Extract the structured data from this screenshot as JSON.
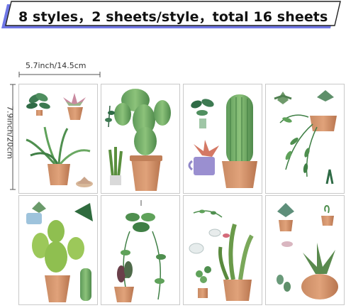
{
  "banner": {
    "text": "8 styles，2 sheets/style，total 16 sheets"
  },
  "dimensions": {
    "width_label": "5.7inch/14.5cm",
    "height_label": "7.9inch/20cm"
  },
  "sheets": [
    {
      "name": "sheet-1",
      "subjects": [
        "calathea",
        "succulent-in-pot",
        "snake-grass-pot",
        "small-succulent"
      ]
    },
    {
      "name": "sheet-2",
      "subjects": [
        "paddle-cactus-pot",
        "hanging-leaves",
        "snake-plant-small"
      ]
    },
    {
      "name": "sheet-3",
      "subjects": [
        "calathea-small",
        "tall-cactus-pot",
        "bromeliad-mug"
      ]
    },
    {
      "name": "sheet-4",
      "subjects": [
        "echeveria",
        "succulent",
        "hanging-vine-pot",
        "fern"
      ]
    },
    {
      "name": "sheet-5",
      "subjects": [
        "succulent-cup",
        "monstera-leaf",
        "prickly-pear-pot",
        "columnar-cactus"
      ]
    },
    {
      "name": "sheet-6",
      "subjects": [
        "hanging-pothos",
        "begonia-pot"
      ]
    },
    {
      "name": "sheet-7",
      "subjects": [
        "vine-sprig",
        "leaf-stickers",
        "pilea-pot",
        "snake-plant-pot"
      ]
    },
    {
      "name": "sheet-8",
      "subjects": [
        "echeveria-pot",
        "small-plant-pot",
        "succulent-leaves",
        "aloe-pot"
      ]
    }
  ]
}
